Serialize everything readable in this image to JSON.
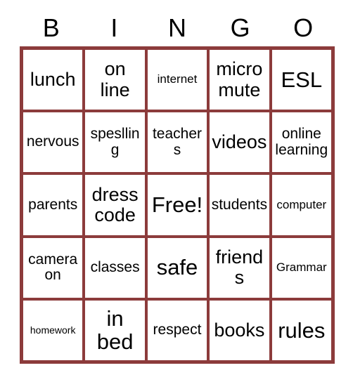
{
  "card": {
    "title": "BINGO card",
    "border_color": "#8C3B3B",
    "text_color": "#000000",
    "background_color": "#FFFFFF",
    "header": {
      "letters": [
        "B",
        "I",
        "N",
        "G",
        "O"
      ]
    },
    "grid": {
      "columns": 5,
      "rows": 5,
      "cells": [
        [
          {
            "text": "lunch",
            "size": "lg"
          },
          {
            "text": "on\nline",
            "size": "lg"
          },
          {
            "text": "internet",
            "size": "sm"
          },
          {
            "text": "micro\nmute",
            "size": "lg"
          },
          {
            "text": "ESL",
            "size": "xl"
          }
        ],
        [
          {
            "text": "nervous",
            "size": "md"
          },
          {
            "text": "speslling",
            "size": "md"
          },
          {
            "text": "teachers",
            "size": "md"
          },
          {
            "text": "videos",
            "size": "lg"
          },
          {
            "text": "online\nlearning",
            "size": "md"
          }
        ],
        [
          {
            "text": "parents",
            "size": "md"
          },
          {
            "text": "dress\ncode",
            "size": "lg"
          },
          {
            "text": "Free!",
            "size": "xl"
          },
          {
            "text": "students",
            "size": "md"
          },
          {
            "text": "computer",
            "size": "sm"
          }
        ],
        [
          {
            "text": "camera\non",
            "size": "md"
          },
          {
            "text": "classes",
            "size": "md"
          },
          {
            "text": "safe",
            "size": "xl"
          },
          {
            "text": "friends",
            "size": "lg"
          },
          {
            "text": "Grammar",
            "size": "sm"
          }
        ],
        [
          {
            "text": "homework",
            "size": "xs"
          },
          {
            "text": "in\nbed",
            "size": "xl"
          },
          {
            "text": "respect",
            "size": "md"
          },
          {
            "text": "books",
            "size": "lg"
          },
          {
            "text": "rules",
            "size": "xl"
          }
        ]
      ]
    }
  }
}
